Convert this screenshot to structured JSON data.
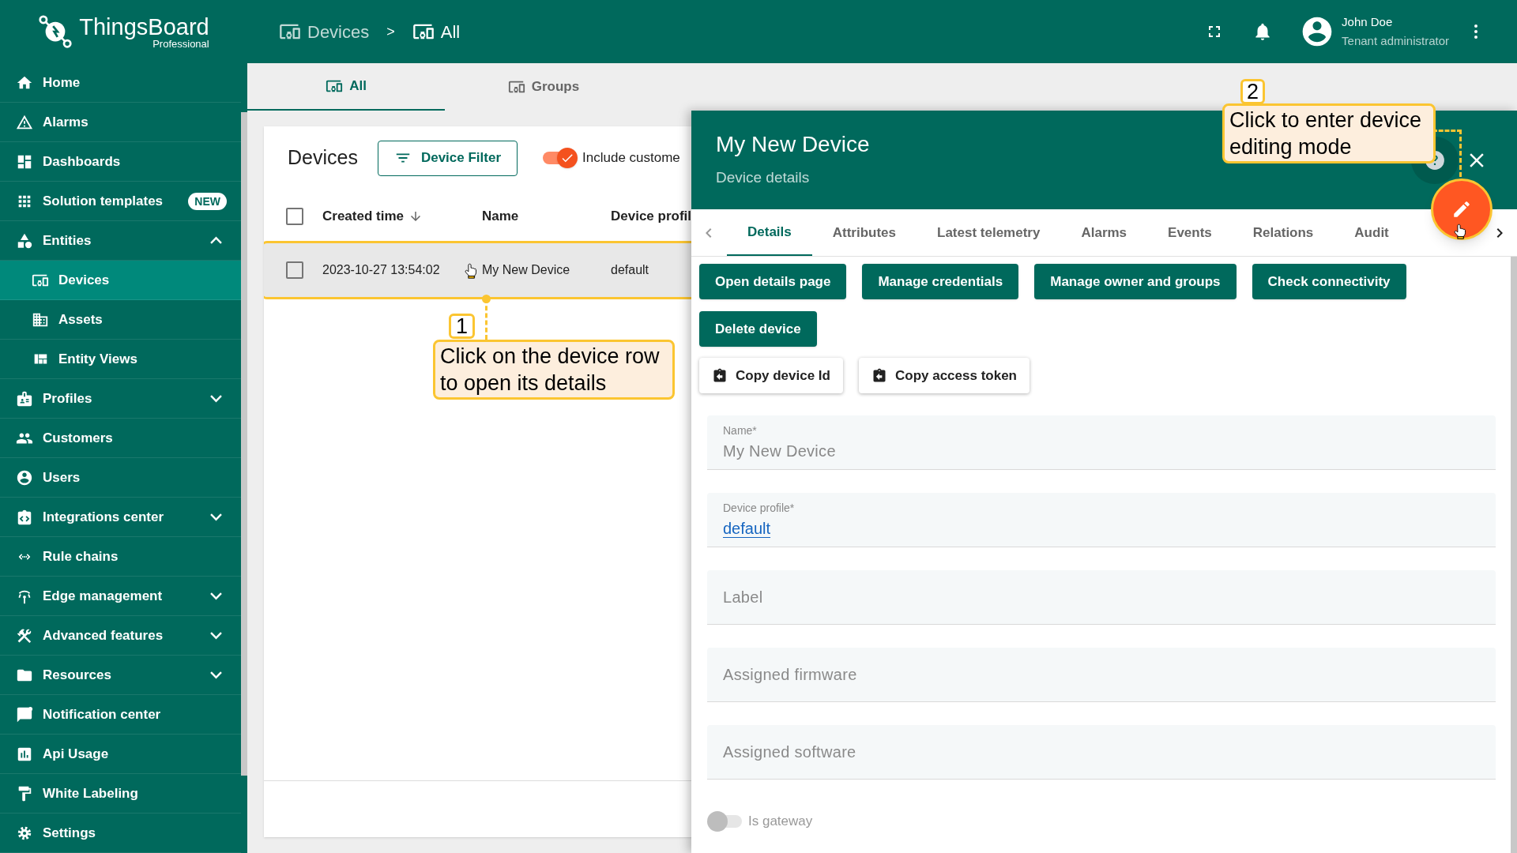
{
  "logo": {
    "name": "ThingsBoard",
    "edition": "Professional"
  },
  "sidebar": {
    "items": [
      {
        "label": "Home",
        "kind": "link",
        "selected": false
      },
      {
        "label": "Alarms",
        "kind": "link",
        "selected": false
      },
      {
        "label": "Dashboards",
        "kind": "link",
        "selected": false
      },
      {
        "label": "Solution templates",
        "kind": "link",
        "selected": false,
        "badge": "NEW"
      },
      {
        "label": "Entities",
        "kind": "group",
        "selected": false,
        "expanded": true,
        "children": [
          {
            "label": "Devices",
            "selected": true
          },
          {
            "label": "Assets",
            "selected": false
          },
          {
            "label": "Entity Views",
            "selected": false
          }
        ]
      },
      {
        "label": "Profiles",
        "kind": "group",
        "selected": false,
        "expanded": false
      },
      {
        "label": "Customers",
        "kind": "link",
        "selected": false
      },
      {
        "label": "Users",
        "kind": "link",
        "selected": false
      },
      {
        "label": "Integrations center",
        "kind": "group",
        "selected": false,
        "expanded": false
      },
      {
        "label": "Rule chains",
        "kind": "link",
        "selected": false
      },
      {
        "label": "Edge management",
        "kind": "group",
        "selected": false,
        "expanded": false
      },
      {
        "label": "Advanced features",
        "kind": "group",
        "selected": false,
        "expanded": false
      },
      {
        "label": "Resources",
        "kind": "group",
        "selected": false,
        "expanded": false
      },
      {
        "label": "Notification center",
        "kind": "link",
        "selected": false
      },
      {
        "label": "Api Usage",
        "kind": "link",
        "selected": false
      },
      {
        "label": "White Labeling",
        "kind": "link",
        "selected": false
      },
      {
        "label": "Settings",
        "kind": "link",
        "selected": false
      }
    ]
  },
  "topbar": {
    "breadcrumb": [
      {
        "label": "Devices",
        "current": false
      },
      {
        "label": "All",
        "current": true
      }
    ],
    "separator": ">",
    "user": {
      "name": "John Doe",
      "role": "Tenant administrator"
    }
  },
  "view_tabs": [
    {
      "label": "All",
      "selected": true
    },
    {
      "label": "Groups",
      "selected": false
    }
  ],
  "devices_card": {
    "title": "Devices",
    "filter_button": "Device Filter",
    "include_customer": {
      "label": "Include custome",
      "on": true
    },
    "table": {
      "all_checked": false,
      "columns": [
        {
          "label": "Created time",
          "sorted": true
        },
        {
          "label": "Name",
          "sorted": false
        },
        {
          "label": "Device profil",
          "sorted": false
        }
      ],
      "rows": [
        {
          "cells": [
            "2023-10-27 13:54:02",
            "My New Device",
            "default"
          ],
          "checked": false,
          "highlighted": true
        }
      ]
    }
  },
  "details_panel": {
    "title": "My New Device",
    "subtitle": "Device details",
    "tabs": [
      {
        "label": "Details",
        "selected": true
      },
      {
        "label": "Attributes",
        "selected": false
      },
      {
        "label": "Latest telemetry",
        "selected": false
      },
      {
        "label": "Alarms",
        "selected": false
      },
      {
        "label": "Events",
        "selected": false
      },
      {
        "label": "Relations",
        "selected": false
      },
      {
        "label": "Audit",
        "selected": false
      }
    ],
    "action_buttons": [
      "Open details page",
      "Manage credentials",
      "Manage owner and groups",
      "Check connectivity",
      "Delete device"
    ],
    "copy_buttons": [
      "Copy device Id",
      "Copy access token"
    ],
    "fields": [
      {
        "kind": "text",
        "label": "Name*",
        "value": "My New Device"
      },
      {
        "kind": "link",
        "label": "Device profile*",
        "value": "default"
      },
      {
        "kind": "empty",
        "placeholder": "Label"
      },
      {
        "kind": "empty",
        "placeholder": "Assigned firmware"
      },
      {
        "kind": "empty",
        "placeholder": "Assigned software"
      }
    ],
    "gateway": {
      "label": "Is gateway",
      "on": false
    }
  },
  "annotations": [
    {
      "number": "1",
      "text": "Click on the device row to open its details"
    },
    {
      "number": "2",
      "text": "Click to enter device editing mode"
    }
  ]
}
